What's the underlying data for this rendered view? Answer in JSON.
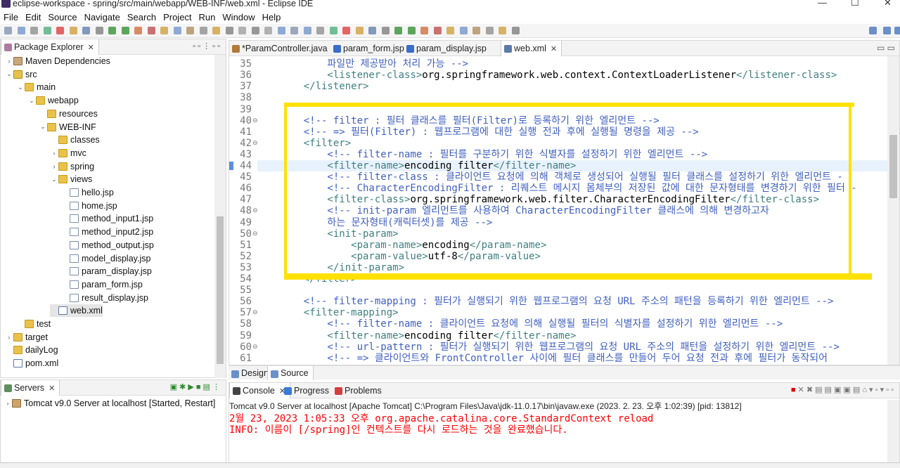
{
  "window": {
    "title": "eclipse-workspace - spring/src/main/webapp/WEB-INF/web.xml - Eclipse IDE"
  },
  "menu": [
    "File",
    "Edit",
    "Source",
    "Navigate",
    "Search",
    "Project",
    "Run",
    "Window",
    "Help"
  ],
  "package_explorer": {
    "title": "Package Explorer",
    "items": [
      {
        "label": "Maven Dependencies",
        "depth": 1,
        "arrow": "›",
        "icon": "jar"
      },
      {
        "label": "src",
        "depth": 1,
        "arrow": "⌄",
        "icon": "src"
      },
      {
        "label": "main",
        "depth": 2,
        "arrow": "⌄",
        "icon": "folder"
      },
      {
        "label": "webapp",
        "depth": 3,
        "arrow": "⌄",
        "icon": "folder"
      },
      {
        "label": "resources",
        "depth": 4,
        "arrow": "",
        "icon": "folder"
      },
      {
        "label": "WEB-INF",
        "depth": 4,
        "arrow": "⌄",
        "icon": "folder"
      },
      {
        "label": "classes",
        "depth": 5,
        "arrow": "",
        "icon": "folder"
      },
      {
        "label": "mvc",
        "depth": 5,
        "arrow": "›",
        "icon": "folder"
      },
      {
        "label": "spring",
        "depth": 5,
        "arrow": "›",
        "icon": "folder"
      },
      {
        "label": "views",
        "depth": 5,
        "arrow": "⌄",
        "icon": "folder"
      },
      {
        "label": "hello.jsp",
        "depth": 6,
        "arrow": "",
        "icon": "file"
      },
      {
        "label": "home.jsp",
        "depth": 6,
        "arrow": "",
        "icon": "file"
      },
      {
        "label": "method_input1.jsp",
        "depth": 6,
        "arrow": "",
        "icon": "file"
      },
      {
        "label": "method_input2.jsp",
        "depth": 6,
        "arrow": "",
        "icon": "file"
      },
      {
        "label": "method_output.jsp",
        "depth": 6,
        "arrow": "",
        "icon": "file"
      },
      {
        "label": "model_display.jsp",
        "depth": 6,
        "arrow": "",
        "icon": "file"
      },
      {
        "label": "param_display.jsp",
        "depth": 6,
        "arrow": "",
        "icon": "file"
      },
      {
        "label": "param_form.jsp",
        "depth": 6,
        "arrow": "",
        "icon": "file"
      },
      {
        "label": "result_display.jsp",
        "depth": 6,
        "arrow": "",
        "icon": "file"
      },
      {
        "label": "web.xml",
        "depth": 5,
        "arrow": "",
        "icon": "xml"
      },
      {
        "label": "test",
        "depth": 2,
        "arrow": "",
        "icon": "folder"
      },
      {
        "label": "target",
        "depth": 1,
        "arrow": "›",
        "icon": "folder"
      },
      {
        "label": "dailyLog",
        "depth": 1,
        "arrow": "",
        "icon": "folder"
      },
      {
        "label": "pom.xml",
        "depth": 1,
        "arrow": "",
        "icon": "xml"
      }
    ]
  },
  "editor_tabs": [
    "*ParamController.java",
    "param_form.jsp",
    "param_display.jsp",
    "web.xml"
  ],
  "code_lines": [
    {
      "n": "",
      "t": [
        [
          "cm",
          "        파일만 제공받아 처리 가능 -->"
        ]
      ]
    },
    {
      "n": "35",
      "t": [
        [
          "cm",
          "        파일만 제공받아 처리 가능 -->"
        ]
      ]
    },
    {
      "n": "36",
      "t": [
        [
          "tg",
          "        <listener-class>"
        ],
        [
          "tx",
          "org.springframework.web.context.ContextLoaderListener"
        ],
        [
          "tg",
          "</listener-class>"
        ]
      ]
    },
    {
      "n": "37",
      "t": [
        [
          "tg",
          "    </listener>"
        ]
      ]
    },
    {
      "n": "38",
      "t": []
    },
    {
      "n": "39",
      "t": []
    },
    {
      "n": "40",
      "f": true,
      "t": [
        [
          "cm",
          "    <!-- filter : 필터 클래스를 필터(Filter)로 등록하기 위한 엘리먼트 -->"
        ]
      ]
    },
    {
      "n": "41",
      "t": [
        [
          "cm",
          "    <!-- => 필터(Filter) : 웹프로그램에 대한 실행 전과 후에 실행될 명령을 제공 -->"
        ]
      ]
    },
    {
      "n": "42",
      "f": true,
      "t": [
        [
          "tg",
          "    <filter>"
        ]
      ]
    },
    {
      "n": "43",
      "t": [
        [
          "cm",
          "        <!-- filter-name : 필터를 구분하기 위한 식별자를 설정하기 위한 엘리먼트 -->"
        ]
      ]
    },
    {
      "n": "44",
      "hl": true,
      "t": [
        [
          "tg",
          "        <filter-name>"
        ],
        [
          "tx",
          "encoding filter"
        ],
        [
          "tg",
          "</filter-name>"
        ]
      ]
    },
    {
      "n": "45",
      "t": [
        [
          "cm",
          "        <!-- filter-class : 클라이언트 요청에 의해 객체로 생성되어 실행될 필터 클래스를 설정하기 위한 엘리먼트 -"
        ]
      ]
    },
    {
      "n": "46",
      "t": [
        [
          "cm",
          "        <!-- CharacterEncodingFilter : 리퀘스트 메시지 몸체부의 저장된 값에 대한 문자형태를 변경하기 위한 필터 -"
        ]
      ]
    },
    {
      "n": "47",
      "t": [
        [
          "tg",
          "        <filter-class>"
        ],
        [
          "tx",
          "org.springframework.web.filter.CharacterEncodingFilter"
        ],
        [
          "tg",
          "</filter-class>"
        ]
      ]
    },
    {
      "n": "48",
      "f": true,
      "t": [
        [
          "cm",
          "        <!-- init-param 엘리먼트를 사용하여 CharacterEncodingFilter 클래스에 의해 변경하고자"
        ]
      ]
    },
    {
      "n": "49",
      "t": [
        [
          "cm",
          "        하는 문자형태(캐릭터셋)를 제공 -->"
        ]
      ]
    },
    {
      "n": "50",
      "f": true,
      "t": [
        [
          "tg",
          "        <init-param>"
        ]
      ]
    },
    {
      "n": "51",
      "t": [
        [
          "tg",
          "            <param-name>"
        ],
        [
          "tx",
          "encoding"
        ],
        [
          "tg",
          "</param-name>"
        ]
      ]
    },
    {
      "n": "52",
      "t": [
        [
          "tg",
          "            <param-value>"
        ],
        [
          "tx",
          "utf-8"
        ],
        [
          "tg",
          "</param-value>"
        ]
      ]
    },
    {
      "n": "53",
      "t": [
        [
          "tg",
          "        </init-param>"
        ]
      ]
    },
    {
      "n": "54",
      "t": [
        [
          "tg",
          "    </filter>"
        ]
      ]
    },
    {
      "n": "55",
      "t": []
    },
    {
      "n": "56",
      "t": [
        [
          "cm",
          "    <!-- filter-mapping : 필터가 실행되기 위한 웹프로그램의 요청 URL 주소의 패턴을 등록하기 위한 엘리먼트 -->"
        ]
      ]
    },
    {
      "n": "57",
      "f": true,
      "t": [
        [
          "tg",
          "    <filter-mapping>"
        ]
      ]
    },
    {
      "n": "58",
      "t": [
        [
          "cm",
          "        <!-- filter-name : 클라이언트 요청에 의해 실행될 필터의 식별자를 설정하기 위한 엘리먼트 -->"
        ]
      ]
    },
    {
      "n": "59",
      "t": [
        [
          "tg",
          "        <filter-name>"
        ],
        [
          "tx",
          "encoding filter"
        ],
        [
          "tg",
          "</filter-name>"
        ]
      ]
    },
    {
      "n": "60",
      "f": true,
      "t": [
        [
          "cm",
          "        <!-- url-pattern : 필터가 실행되기 위한 웹프로그램의 요청 URL 주소의 패턴을 설정하기 위한 엘리먼트 -->"
        ]
      ]
    },
    {
      "n": "61",
      "t": [
        [
          "cm",
          "        <!-- => 클라이언트와 FrontController 사이에 필터 클래스를 만들어 두어 요청 전과 후에 필터가 동작되어"
        ]
      ]
    }
  ],
  "editor_bottom_tabs": [
    "Design",
    "Source"
  ],
  "servers": {
    "title": "Servers",
    "item": "Tomcat v9.0 Server at localhost  [Started, Restart]"
  },
  "console": {
    "tabs": [
      "Console",
      "Progress",
      "Problems"
    ],
    "header": "Tomcat v9.0 Server at localhost [Apache Tomcat] C:\\Program Files\\Java\\jdk-11.0.17\\bin\\javaw.exe  (2023. 2. 23. 오후 1:02:39) [pid: 13812]",
    "line1": "2월 23, 2023 1:05:33 오후 org.apache.catalina.core.StandardContext reload",
    "line2": "INFO: 이름이 [/spring]인 컨텍스트를 다시 로드하는 것을 완료했습니다."
  },
  "colors": {
    "highlight": "#ffe100",
    "comment": "#3f5fbf",
    "tag": "#3f7f7f",
    "error": "#ff0000"
  }
}
